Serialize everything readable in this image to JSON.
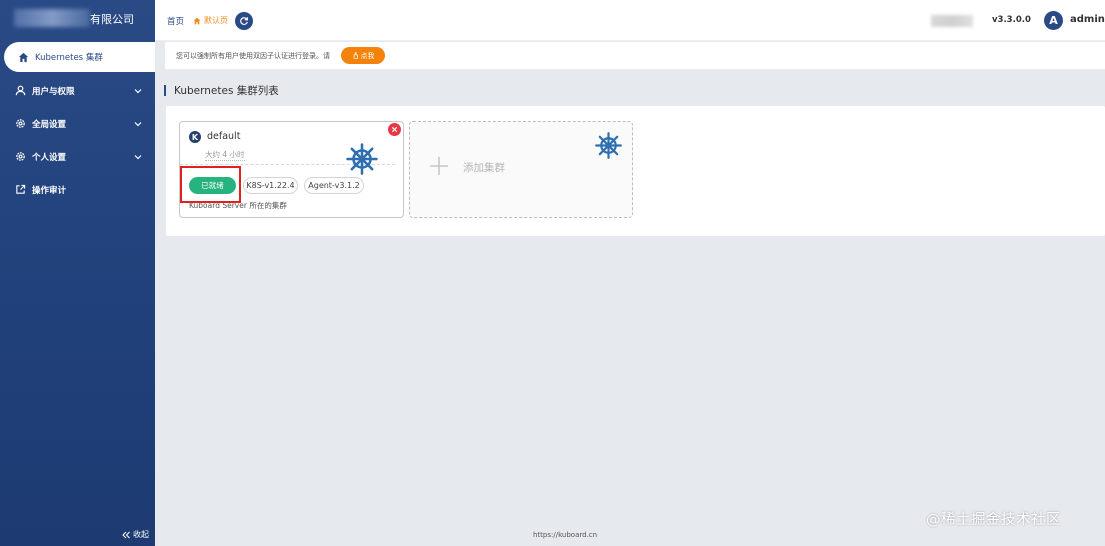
{
  "brand": {
    "suffix": "有限公司"
  },
  "sidebar": {
    "items": [
      {
        "label": "Kubernetes 集群",
        "icon": "home-icon"
      },
      {
        "label": "用户与权限",
        "icon": "user-icon"
      },
      {
        "label": "全局设置",
        "icon": "gear-icon"
      },
      {
        "label": "个人设置",
        "icon": "gear-icon"
      },
      {
        "label": "操作审计",
        "icon": "external-link-icon"
      }
    ],
    "collapse_label": "收起"
  },
  "topbar": {
    "breadcrumb_home": "首页",
    "current_tab": "默认页",
    "version": "v3.3.0.0",
    "avatar_letter": "A",
    "username": "admin"
  },
  "notice": {
    "text": "您可以强制所有用户使用双因子认证进行登录。请",
    "button_label": "点我"
  },
  "section": {
    "title": "Kubernetes 集群列表"
  },
  "cluster": {
    "badge": "K",
    "name": "default",
    "time": "大约 4 小时",
    "status": "已就绪",
    "k8s_version": "K8S-v1.22.4",
    "agent_version": "Agent-v3.1.2",
    "description": "Kuboard Server 所在的集群"
  },
  "add_cluster": {
    "label": "添加集群"
  },
  "footer": {
    "url": "https://kuboard.cn"
  },
  "watermark": "@稀土掘金技术社区",
  "colors": {
    "sidebar": "#2a4a86",
    "accent_orange": "#f5820b",
    "status_green": "#27b37d",
    "close_red": "#e53945",
    "highlight_red": "#e32020",
    "wheel_blue": "#2f6fb0"
  }
}
